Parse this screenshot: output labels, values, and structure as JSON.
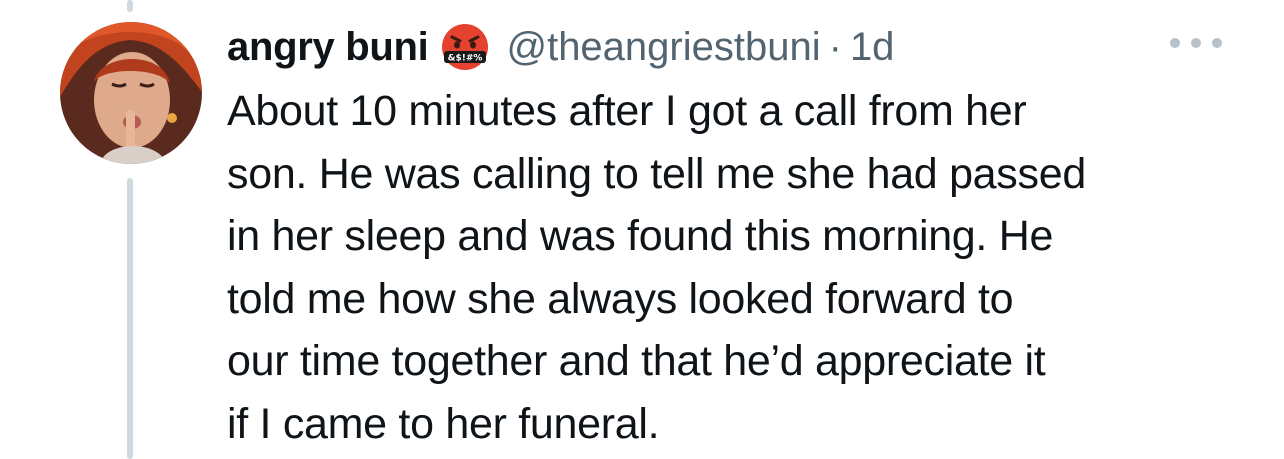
{
  "tweet": {
    "display_name": "angry buni",
    "badge_emoji": "face-with-symbols-on-mouth-emoji",
    "badge_text": "&$!#%",
    "handle": "@theangriestbuni",
    "separator": "·",
    "timestamp": "1d",
    "more_icon": "more-horizontal-icon",
    "text_lines": [
      "About 10 minutes after I got a call from her",
      "son. He was calling to tell me she had passed",
      "in her sleep and was found this morning. He",
      "told me how she always looked forward to",
      "our time together and that he’d appreciate it",
      "if I came to her funeral."
    ]
  },
  "colors": {
    "text_primary": "#0f1419",
    "text_secondary": "#536471",
    "thread_line": "#cfd9de",
    "emoji_red": "#e4412e",
    "more_dots": "#b7c1c9"
  }
}
